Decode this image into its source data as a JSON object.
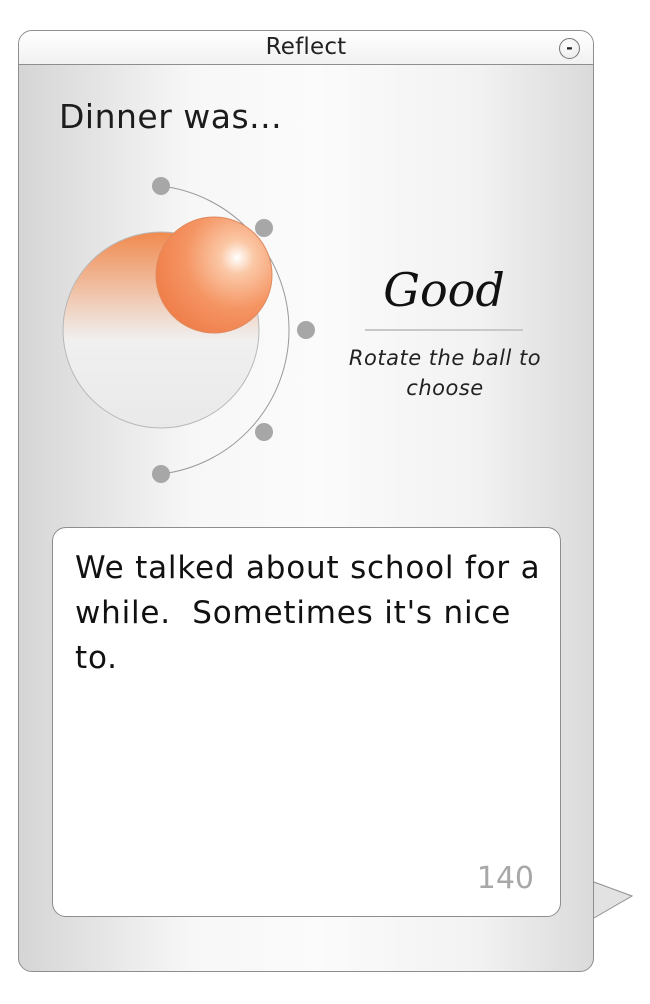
{
  "window": {
    "title": "Reflect",
    "minimize_label": "-"
  },
  "prompt": "Dinner was...",
  "rating": {
    "selected_label": "Good",
    "selected_index": 1,
    "option_count": 5,
    "hint": "Rotate the ball to choose",
    "accent_color": "#f0834a"
  },
  "entry": {
    "text": "We talked about school for a while.  Sometimes it's nice to.",
    "chars_remaining": "140"
  }
}
